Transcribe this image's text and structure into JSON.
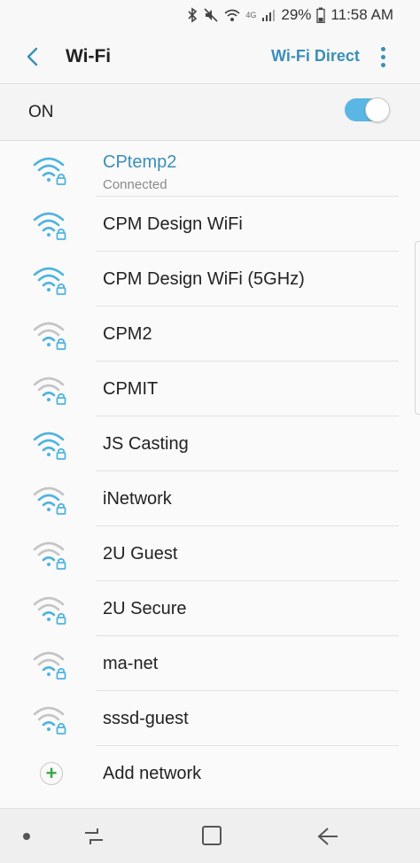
{
  "status_bar": {
    "network_type": "4G",
    "battery_percent": "29%",
    "time": "11:58 AM"
  },
  "header": {
    "title": "Wi-Fi",
    "action_label": "Wi-Fi Direct"
  },
  "toggle": {
    "label": "ON",
    "state": "on"
  },
  "networks": [
    {
      "ssid": "CPtemp2",
      "status": "Connected",
      "strength": "strong",
      "secured": true
    },
    {
      "ssid": "CPM Design WiFi",
      "strength": "strong",
      "secured": true
    },
    {
      "ssid": "CPM Design WiFi (5GHz)",
      "strength": "strong",
      "secured": true
    },
    {
      "ssid": "CPM2",
      "strength": "weak",
      "secured": true
    },
    {
      "ssid": "CPMIT",
      "strength": "weak",
      "secured": true
    },
    {
      "ssid": "JS Casting",
      "strength": "strong",
      "secured": true
    },
    {
      "ssid": "iNetwork",
      "strength": "medium",
      "secured": true
    },
    {
      "ssid": "2U Guest",
      "strength": "weak",
      "secured": true
    },
    {
      "ssid": "2U Secure",
      "strength": "weak",
      "secured": true
    },
    {
      "ssid": "ma-net",
      "strength": "weak",
      "secured": true
    },
    {
      "ssid": "sssd-guest",
      "strength": "weak",
      "secured": true
    }
  ],
  "add_network": {
    "label": "Add network"
  },
  "colors": {
    "accent": "#3a8fb8",
    "toggle_on": "#5ab6e4",
    "signal_active": "#4fb3e0",
    "signal_inactive": "#c4c4c4",
    "add_green": "#3aa84a"
  }
}
